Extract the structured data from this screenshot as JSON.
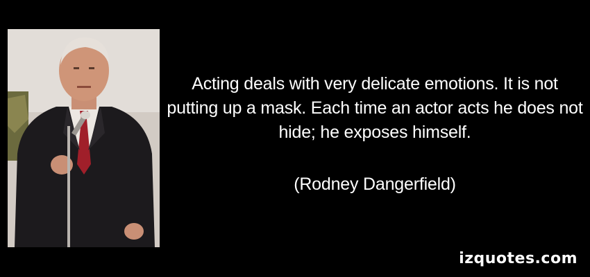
{
  "quote": {
    "text": "Acting deals with very delicate emotions. It is not putting up a mask. Each time an actor acts he does not hide; he exposes himself.",
    "author": "(Rodney Dangerfield)"
  },
  "watermark": {
    "text": "izquotes.com"
  },
  "colors": {
    "background": "#000000",
    "text": "#ffffff"
  }
}
